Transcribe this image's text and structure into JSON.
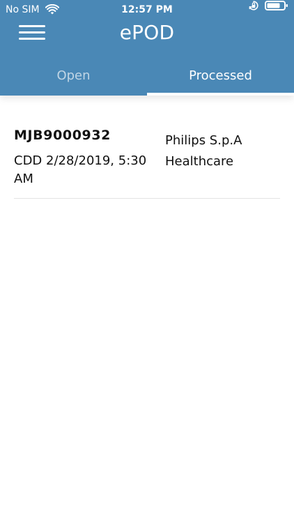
{
  "status_bar": {
    "carrier": "No SIM",
    "time": "12:57 PM",
    "icons": {
      "wifi": "wifi-icon",
      "orientation_lock": "orientation-lock-icon",
      "battery": "battery-icon"
    }
  },
  "header": {
    "title": "ePOD",
    "menu_icon": "hamburger-menu-icon",
    "background_color": "#4a88b6"
  },
  "tabs": [
    {
      "label": "Open",
      "active": false
    },
    {
      "label": "Processed",
      "active": true
    }
  ],
  "list": {
    "items": [
      {
        "order_id": "MJB9000932",
        "cdd": "CDD 2/28/2019, 5:30 AM",
        "company_line1": "Philips S.p.A",
        "company_line2": "Healthcare"
      }
    ]
  }
}
